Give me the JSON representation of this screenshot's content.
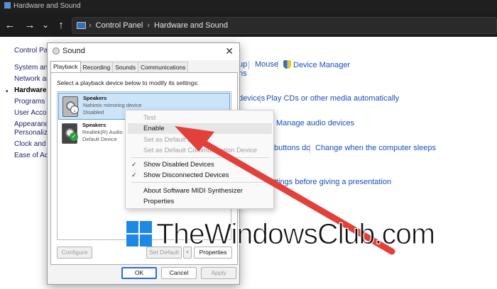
{
  "window": {
    "title": "Hardware and Sound"
  },
  "nav": {
    "back_icon": "←",
    "forward_icon": "→",
    "recent_icon": "⌄",
    "up_icon": "↑",
    "breadcrumb": [
      "Control Panel",
      "Hardware and Sound"
    ],
    "separator": "›"
  },
  "sidebar": {
    "items": [
      "Control Panel",
      "System and",
      "Network and",
      "Hardware a",
      "Programs",
      "User Accou",
      "Appearance",
      "Personalizat",
      "Clock and R",
      "Ease of Acc"
    ],
    "active_index": 3
  },
  "background_links": {
    "setup": "up",
    "mouse": "Mouse",
    "device_manager": "Device Manager",
    "options": "ns",
    "devices": "devices",
    "play_cds": "Play CDs or other media automatically",
    "manage_audio": "Manage audio devices",
    "buttons_do": "buttons do",
    "change_sleep": "Change when the computer sleeps",
    "presentation": "ttings before giving a presentation"
  },
  "dialog": {
    "title": "Sound",
    "close": "✕",
    "tabs": [
      "Playback",
      "Recording",
      "Sounds",
      "Communications"
    ],
    "selected_tab": 0,
    "instruction": "Select a playback device below to modify its settings:",
    "devices": [
      {
        "name": "Speakers",
        "desc": "Nahimic mirroring device",
        "status": "Disabled"
      },
      {
        "name": "Speakers",
        "desc": "Realtek(R) Audio",
        "status": "Default Device"
      }
    ],
    "buttons": {
      "configure": "Configure",
      "set_default": "Set Default",
      "properties": "Properties",
      "ok": "OK",
      "cancel": "Cancel",
      "apply": "Apply"
    }
  },
  "context_menu": {
    "test": "Test",
    "enable": "Enable",
    "set_default": "Set as Default Device",
    "set_default_comm": "Set as Default Communication Device",
    "show_disabled": "Show Disabled Devices",
    "show_disconnected": "Show Disconnected Devices",
    "about_midi": "About Software MIDI Synthesizer",
    "properties": "Properties",
    "check": "✓"
  },
  "watermark": {
    "text": "TheWindowsClub.com"
  },
  "colors": {
    "arrow": "#e2403a",
    "accent": "#2a6cd2",
    "link": "#1a4fb8"
  }
}
